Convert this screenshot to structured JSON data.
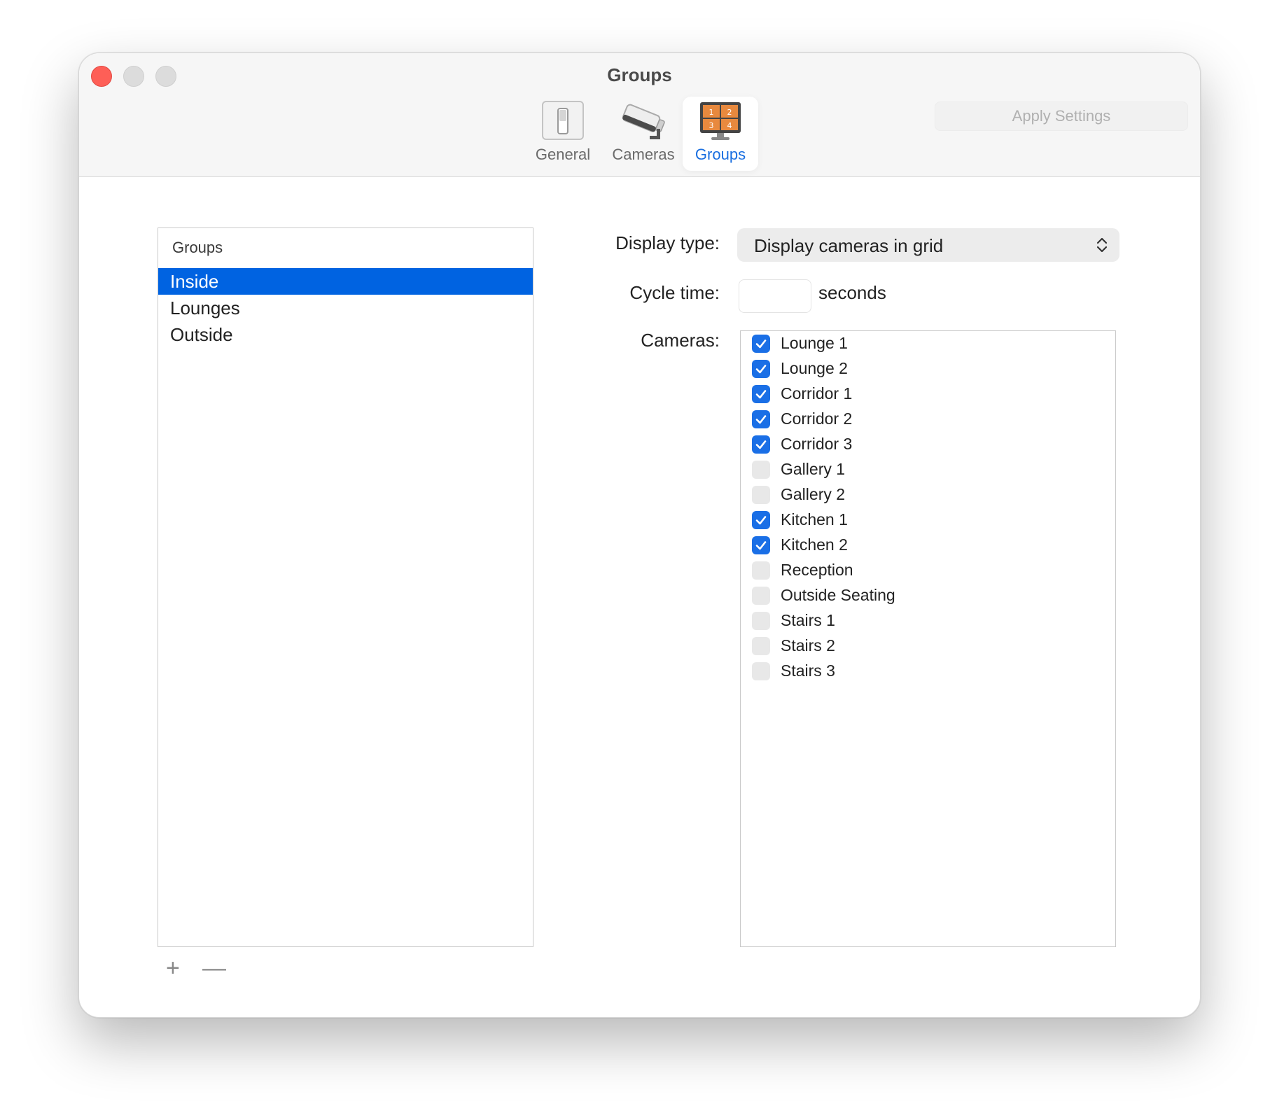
{
  "window": {
    "title": "Groups"
  },
  "toolbar": {
    "items": [
      {
        "label": "General",
        "icon": "switch-icon",
        "active": false
      },
      {
        "label": "Cameras",
        "icon": "security-camera-icon",
        "active": false
      },
      {
        "label": "Groups",
        "icon": "grid-monitor-icon",
        "active": true
      }
    ],
    "grid_numbers": [
      "1",
      "2",
      "3",
      "4"
    ],
    "apply_label": "Apply Settings"
  },
  "groups": {
    "header": "Groups",
    "items": [
      "Inside",
      "Lounges",
      "Outside"
    ],
    "selected": "Inside",
    "add_label": "+",
    "remove_label": "—"
  },
  "form": {
    "display_type_label": "Display type:",
    "display_type_value": "Display cameras in grid",
    "cycle_time_label": "Cycle time:",
    "cycle_time_value": "",
    "cycle_time_unit": "seconds",
    "cameras_label": "Cameras:"
  },
  "cameras": [
    {
      "name": "Lounge 1",
      "checked": true
    },
    {
      "name": "Lounge 2",
      "checked": true
    },
    {
      "name": "Corridor 1",
      "checked": true
    },
    {
      "name": "Corridor 2",
      "checked": true
    },
    {
      "name": "Corridor 3",
      "checked": true
    },
    {
      "name": "Gallery 1",
      "checked": false
    },
    {
      "name": "Gallery 2",
      "checked": false
    },
    {
      "name": "Kitchen 1",
      "checked": true
    },
    {
      "name": "Kitchen 2",
      "checked": true
    },
    {
      "name": "Reception",
      "checked": false
    },
    {
      "name": "Outside Seating",
      "checked": false
    },
    {
      "name": "Stairs 1",
      "checked": false
    },
    {
      "name": "Stairs 2",
      "checked": false
    },
    {
      "name": "Stairs 3",
      "checked": false
    }
  ],
  "colors": {
    "accent": "#0063e1",
    "checkbox_checked": "#1a6fe6",
    "close_button": "#fe5f57",
    "grid_icon_orange": "#e8893e"
  }
}
